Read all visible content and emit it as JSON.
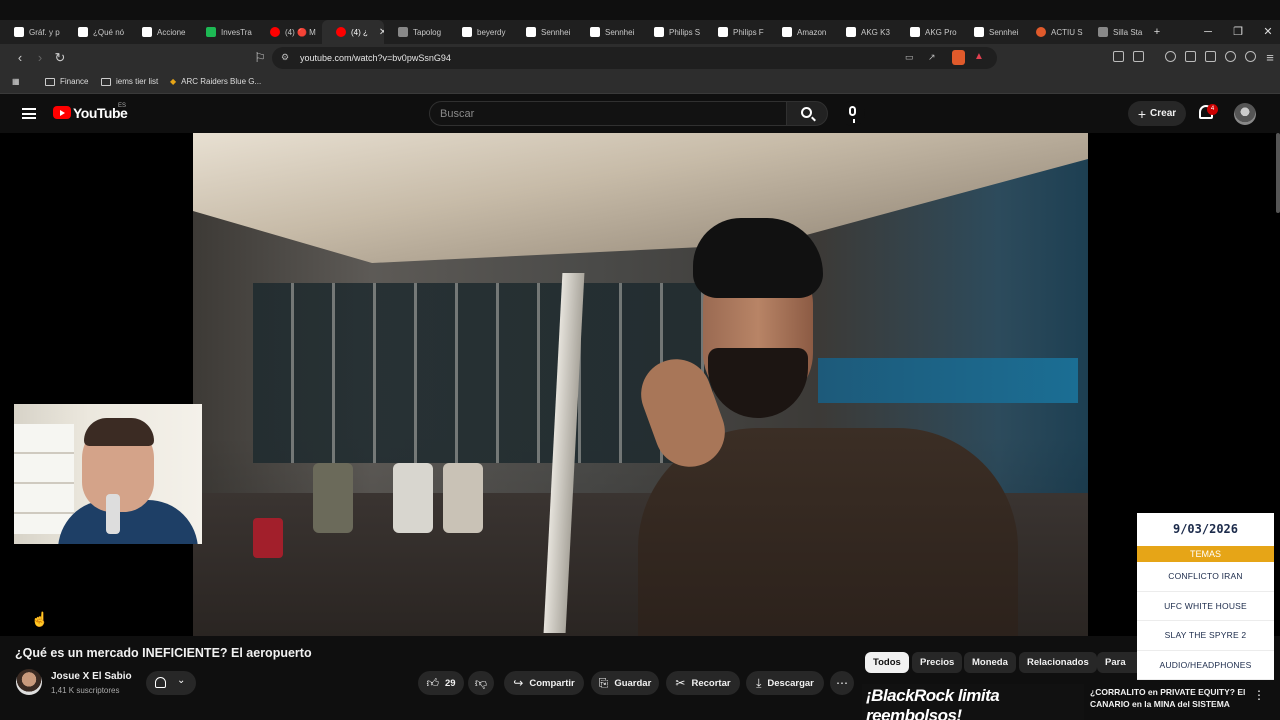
{
  "browser": {
    "tabs": [
      {
        "label": "Gráf. y p",
        "color": "#ffffff"
      },
      {
        "label": "¿Qué nó",
        "color": "#ffffff"
      },
      {
        "label": "Accione",
        "color": "#ffffff"
      },
      {
        "label": "InvesTra",
        "color": "#1db954"
      },
      {
        "label": "(4) 🔴 M",
        "color": "#ff0000"
      },
      {
        "label": "(4) ¿",
        "color": "#ff0000"
      },
      {
        "label": "Tapolog",
        "color": "#aaaaaa"
      },
      {
        "label": "beyerdy",
        "color": "#ffffff"
      },
      {
        "label": "Sennhei",
        "color": "#ffffff"
      },
      {
        "label": "Sennhei",
        "color": "#ffffff"
      },
      {
        "label": "Philips S",
        "color": "#ffffff"
      },
      {
        "label": "Philips F",
        "color": "#ffffff"
      },
      {
        "label": "Amazon",
        "color": "#ffffff"
      },
      {
        "label": "AKG K3",
        "color": "#ffffff"
      },
      {
        "label": "AKG Pro",
        "color": "#ffffff"
      },
      {
        "label": "Sennhei",
        "color": "#ffffff"
      },
      {
        "label": "ACTIU S",
        "color": "#e05a2b"
      },
      {
        "label": "Silla Sta",
        "color": "#aaaaaa"
      }
    ],
    "url": "youtube.com/watch?v=bv0pwSsnG94",
    "bookmarks": [
      "Finance",
      "iems tier list",
      "ARC Raiders Blue G..."
    ]
  },
  "youtube": {
    "logo_text": "YouTube",
    "region": "ES",
    "search_placeholder": "Buscar",
    "create_label": "Crear",
    "notifications": "4"
  },
  "topics_widget": {
    "date": "9/03/2026",
    "heading": "TEMAS",
    "items": [
      "CONFLICTO IRAN",
      "UFC WHITE HOUSE",
      "SLAY THE SPYRE 2",
      "AUDIO/HEADPHONES"
    ]
  },
  "video": {
    "title": "¿Qué es un mercado INEFICIENTE? El aeropuerto",
    "channel": "Josue X El Sabio",
    "subscribers": "1,41 K suscriptores",
    "likes": "29",
    "share_label": "Compartir",
    "save_label": "Guardar",
    "clip_label": "Recortar",
    "download_label": "Descargar"
  },
  "chips": [
    "Todos",
    "Precios",
    "Moneda",
    "Relacionados",
    "Para ti"
  ],
  "next_video": {
    "thumb_text": "¡BlackRock limita reembolsos!",
    "title": "¿CORRALITO en PRIVATE EQUITY? El CANARIO en la MINA del SISTEMA"
  },
  "colors": {
    "youtube_red": "#ff0000",
    "widget_accent": "#e6a517",
    "background": "#0f0f0f"
  }
}
